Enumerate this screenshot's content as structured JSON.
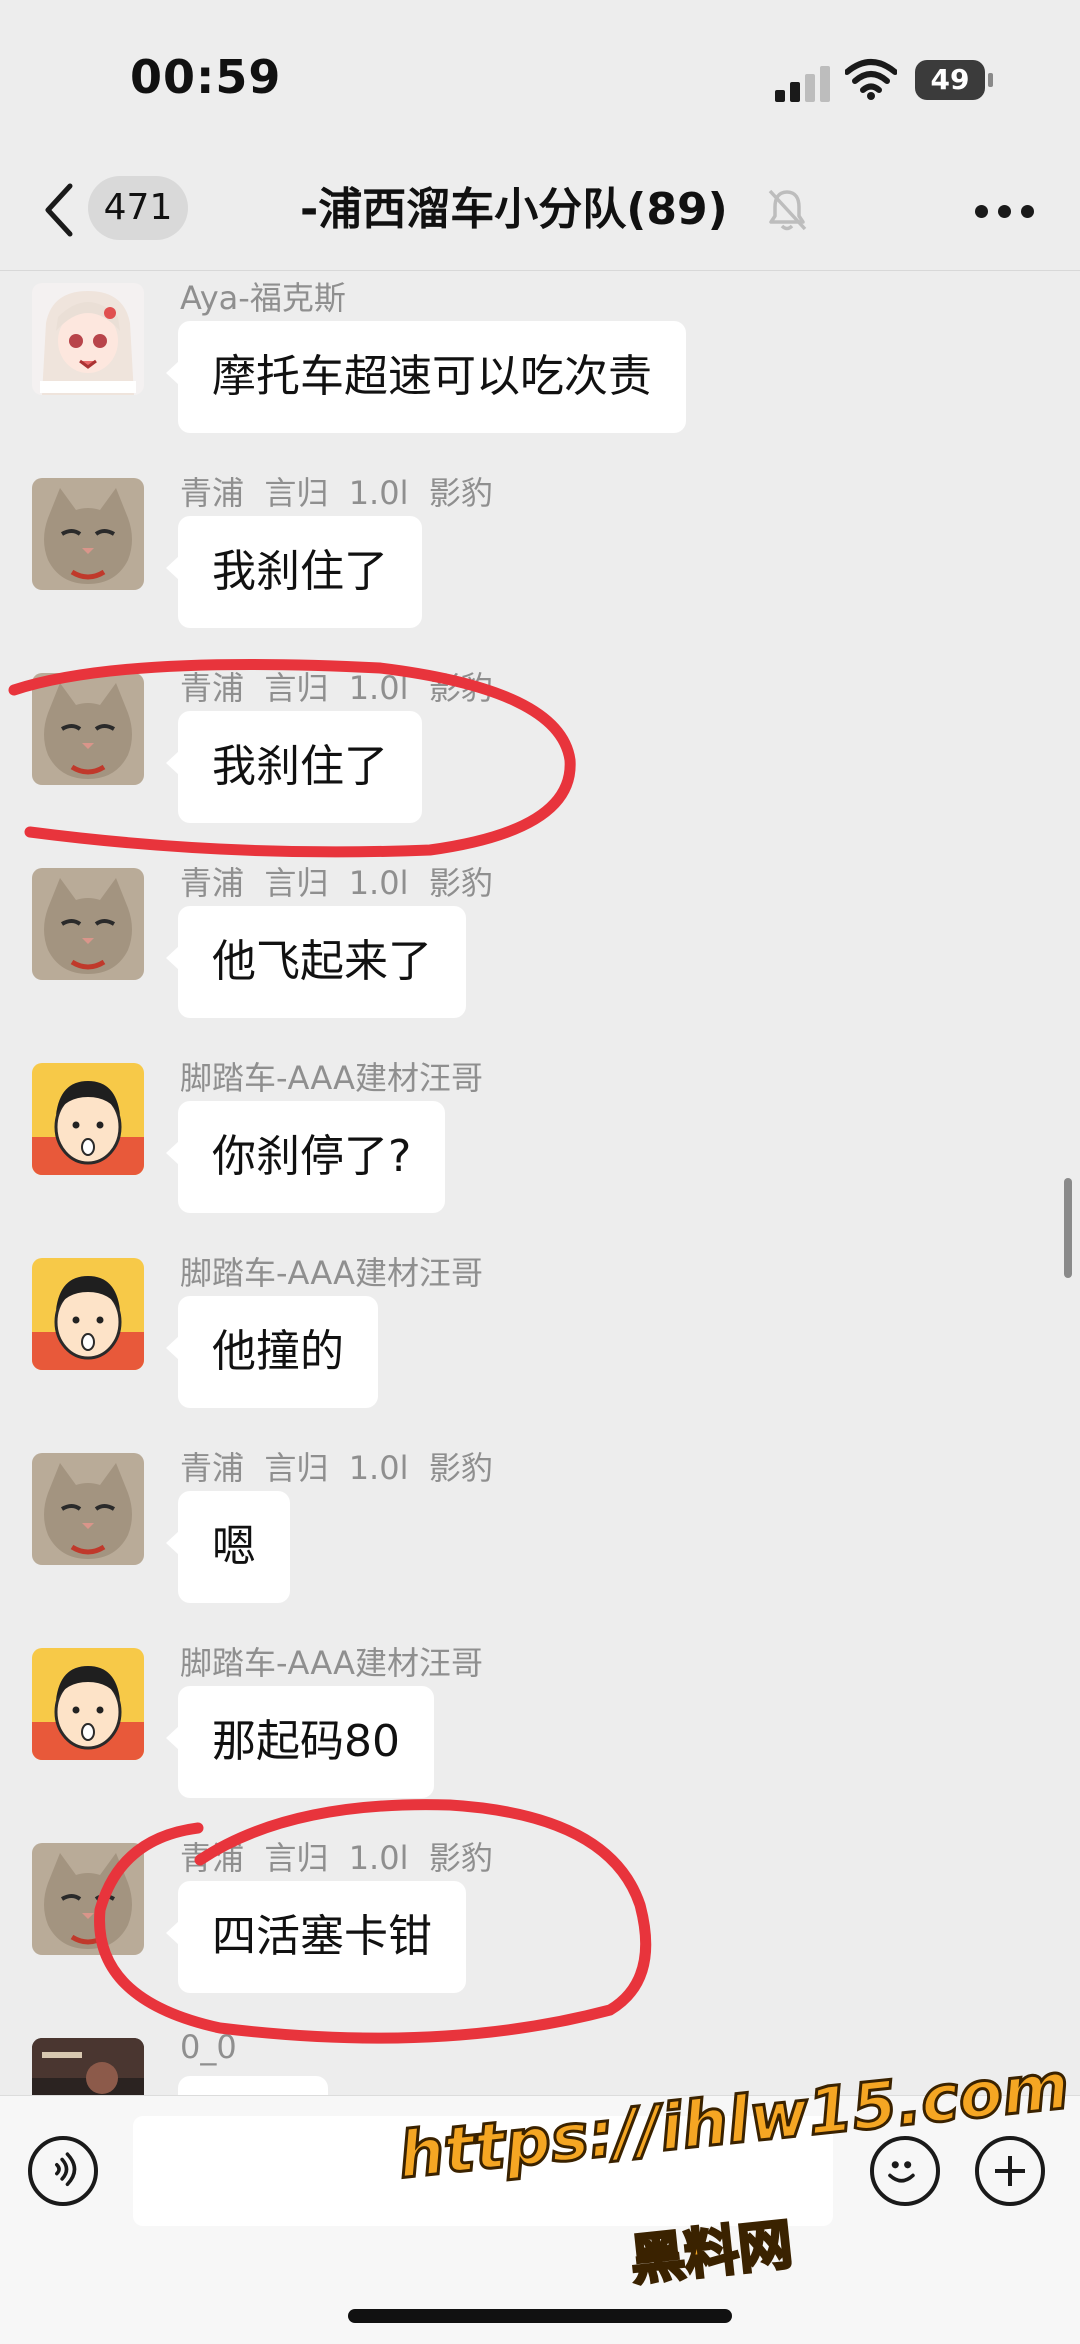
{
  "status_bar": {
    "time": "00:59",
    "battery": "49"
  },
  "nav": {
    "unread_count": "471",
    "title": "-浦西溜车小分队(89)"
  },
  "messages": [
    {
      "sender": "Aya-福克斯",
      "text": "摩托车超速可以吃次责",
      "avatar": "anime-girl"
    },
    {
      "sender": "青浦  言归  1.0l  影豹",
      "text": "我刹住了",
      "avatar": "cat"
    },
    {
      "sender": "青浦  言归  1.0l  影豹",
      "text": "我刹住了",
      "avatar": "cat"
    },
    {
      "sender": "青浦  言归  1.0l  影豹",
      "text": "他飞起来了",
      "avatar": "cat"
    },
    {
      "sender": "脚踏车-AAA建材汪哥",
      "text": "你刹停了?",
      "avatar": "cartoon-boy"
    },
    {
      "sender": "脚踏车-AAA建材汪哥",
      "text": "他撞的",
      "avatar": "cartoon-boy"
    },
    {
      "sender": "青浦  言归  1.0l  影豹",
      "text": "嗯",
      "avatar": "cat"
    },
    {
      "sender": "脚踏车-AAA建材汪哥",
      "text": "那起码80",
      "avatar": "cartoon-boy"
    },
    {
      "sender": "青浦  言归  1.0l  影豹",
      "text": "四活塞卡钳",
      "avatar": "cat"
    },
    {
      "sender": "0_0",
      "text": "",
      "avatar": "photo"
    }
  ],
  "composer": {
    "input_value": ""
  },
  "watermark": {
    "url": "https://ihlw15.com",
    "name": "黑料网"
  },
  "colors": {
    "background": "#ededed",
    "bubble": "#ffffff",
    "annotation": "#e8343c",
    "watermark": "#f5a623"
  }
}
